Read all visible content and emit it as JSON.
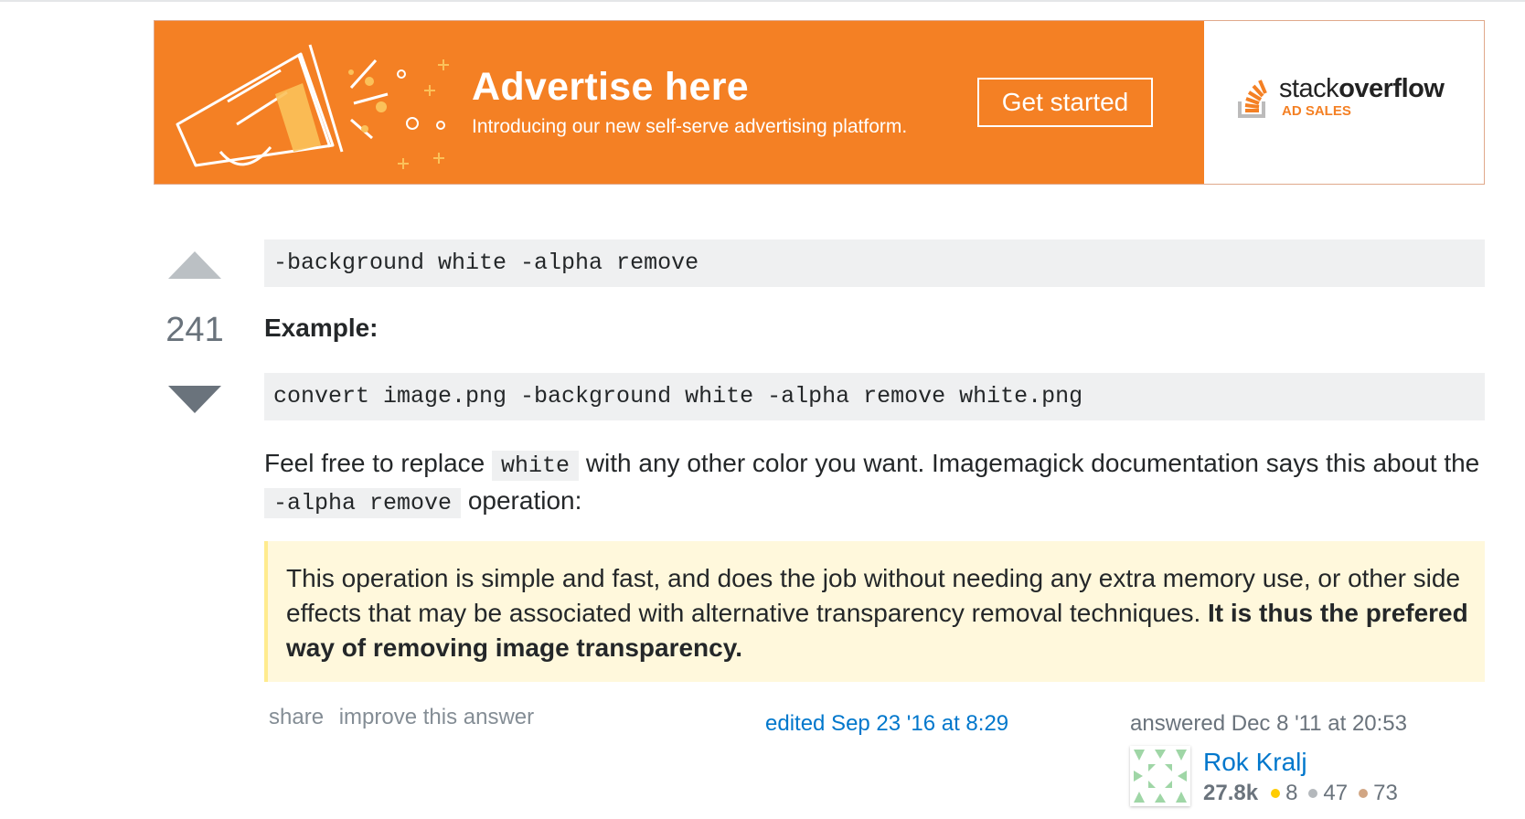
{
  "ad": {
    "title": "Advertise here",
    "subtitle": "Introducing our new self-serve advertising platform.",
    "button_label": "Get started",
    "logo_word_light": "stack",
    "logo_word_bold": "overflow",
    "logo_tag": "AD SALES",
    "brand_color": "#f48024"
  },
  "vote": {
    "count": "241"
  },
  "post": {
    "code1": "-background white -alpha remove",
    "example_label": "Example:",
    "code2": "convert image.png -background white -alpha remove white.png",
    "para_part1": "Feel free to replace ",
    "para_code1": "white",
    "para_part2": " with any other color you want. Imagemagick documentation says this about the ",
    "para_code2": "-alpha remove",
    "para_part3": " operation:",
    "quote_text": "This operation is simple and fast, and does the job without needing any extra memory use, or other side effects that may be associated with alternative transparency removal techniques. ",
    "quote_bold": "It is thus the prefered way of removing image transparency."
  },
  "footer": {
    "share_label": "share",
    "improve_label": "improve this answer",
    "edited_label": "edited Sep 23 '16 at 8:29",
    "answered_label": "answered Dec 8 '11 at 20:53",
    "user": {
      "name": "Rok Kralj",
      "reputation": "27.8k",
      "gold": "8",
      "silver": "47",
      "bronze": "73",
      "gold_color": "#ffcc01",
      "silver_color": "#b4b8bc",
      "bronze_color": "#d1a684"
    }
  }
}
